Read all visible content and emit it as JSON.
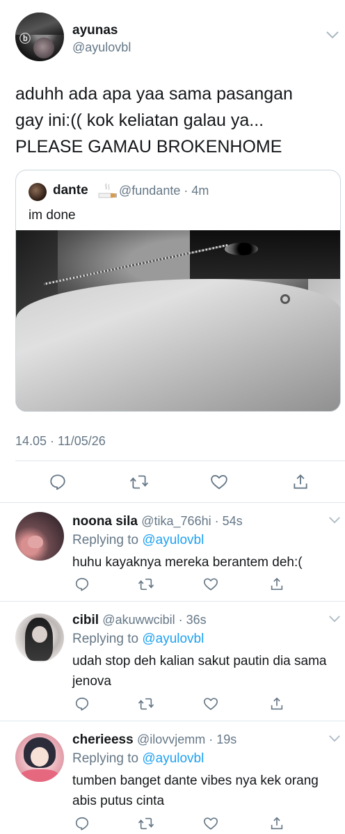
{
  "main_tweet": {
    "name": "ayunas",
    "handle": "@ayulovbl",
    "text": "aduhh ada apa yaa sama pasangan\ngay ini:(( kok keliatan galau ya...\nPLEASE GAMAU BROKENHOME",
    "timestamp": "14.05 · 11/05/26",
    "quote": {
      "name": "dante",
      "emoji": "🚬",
      "handle_time": "@fundante · 4m",
      "text": "im done"
    }
  },
  "actions": {
    "reply_icon": "reply-icon",
    "retweet_icon": "retweet-icon",
    "like_icon": "heart-icon",
    "share_icon": "share-icon"
  },
  "replies": [
    {
      "name": "noona sila",
      "handle_time": "@tika_766hi · 54s",
      "replying_prefix": "Replying to ",
      "replying_to": "@ayulovbl",
      "text": "huhu kayaknya mereka berantem deh:("
    },
    {
      "name": "cibil",
      "handle_time": "@akuwwcibil · 36s",
      "replying_prefix": "Replying to ",
      "replying_to": "@ayulovbl",
      "text": "udah stop deh kalian sakut pautin dia sama jenova"
    },
    {
      "name": "cherieess",
      "handle_time": "@ilovvjemm · 19s",
      "replying_prefix": "Replying to ",
      "replying_to": "@ayulovbl",
      "text": "tumben banget dante vibes nya kek orang abis putus cinta"
    }
  ],
  "colors": {
    "text": "#14171a",
    "secondary": "#657786",
    "link": "#1da1f2",
    "divider": "#e1e8ed"
  }
}
